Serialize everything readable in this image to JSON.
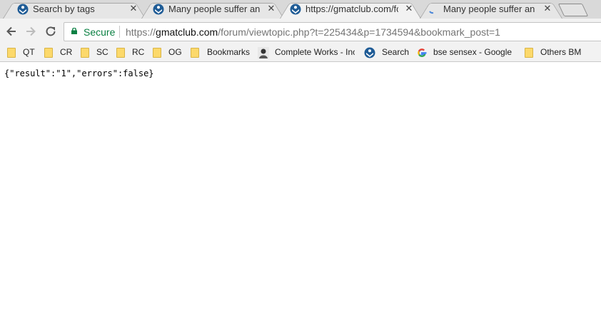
{
  "tabs": [
    {
      "title": "Search by tags",
      "favicon": "gmatclub-icon",
      "active": false
    },
    {
      "title": "Many people suffer an al",
      "favicon": "gmatclub-icon",
      "active": false
    },
    {
      "title": "https://gmatclub.com/fo",
      "favicon": "gmatclub-icon",
      "active": true
    },
    {
      "title": "Many people suffer an al",
      "favicon": "loading-spinner-icon",
      "active": false
    }
  ],
  "toolbar": {
    "secure_label": "Secure",
    "url_scheme": "https://",
    "url_host": "gmatclub.com",
    "url_path": "/forum/viewtopic.php?t=225434&p=1734594&bookmark_post=1"
  },
  "bookmarks": [
    {
      "label": "QT",
      "icon": "folder-icon"
    },
    {
      "label": "CR",
      "icon": "folder-icon"
    },
    {
      "label": "SC",
      "icon": "folder-icon"
    },
    {
      "label": "RC",
      "icon": "folder-icon"
    },
    {
      "label": "OG",
      "icon": "folder-icon"
    },
    {
      "label": "Bookmarks",
      "icon": "folder-icon"
    },
    {
      "label": "Complete Works - Inc",
      "icon": "portrait-icon"
    },
    {
      "label": "Search",
      "icon": "gmatclub-icon"
    },
    {
      "label": "bse sensex - Google S",
      "icon": "google-icon"
    },
    {
      "label": "Others BM",
      "icon": "folder-icon"
    }
  ],
  "page": {
    "body_text": "{\"result\":\"1\",\"errors\":false}"
  },
  "colors": {
    "secure_green": "#0b8043",
    "folder_yellow": "#fcd96b",
    "gmatclub_blue": "#1f5c96"
  }
}
